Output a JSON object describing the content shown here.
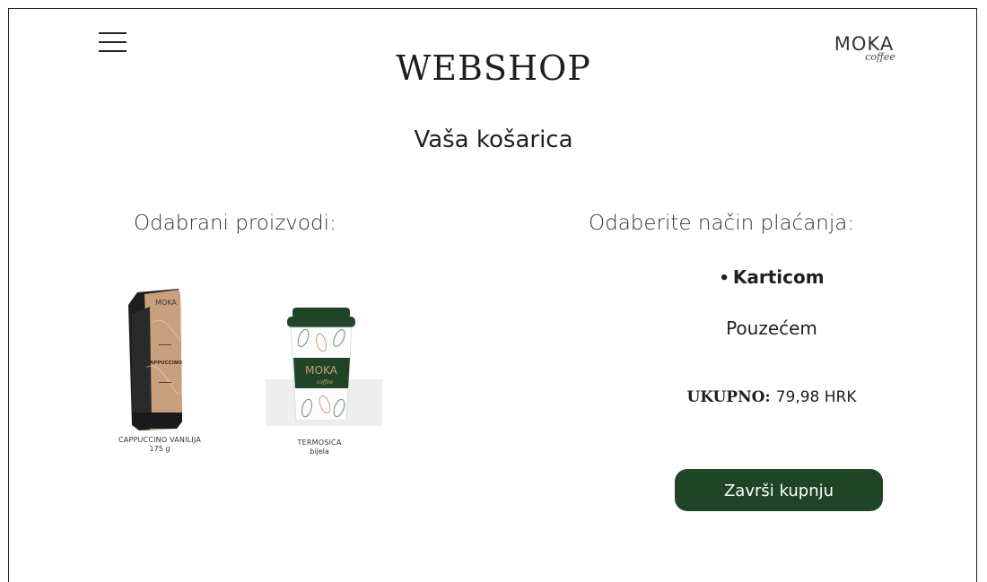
{
  "header": {
    "title": "WEBSHOP",
    "logo_main": "MOKA",
    "logo_sub": "coffee"
  },
  "cart": {
    "title": "Vaša košarica"
  },
  "products_section": {
    "heading": "Odabrani proizvodi:",
    "items": [
      {
        "name": "CAPPUCCINO VANILIJA",
        "detail": "175 g",
        "icon": "coffee-bag-image",
        "package_label": "CAPPUCCINO",
        "brand": "MOKA"
      },
      {
        "name": "TERMOSICA",
        "detail": "bijela",
        "icon": "thermos-cup-image",
        "brand": "MOKA",
        "brand_sub": "coffee"
      }
    ]
  },
  "payment_section": {
    "heading": "Odaberite način plaćanja:",
    "options": [
      {
        "label": "Karticom",
        "selected": true
      },
      {
        "label": "Pouzećem",
        "selected": false
      }
    ],
    "bullet": "•"
  },
  "total": {
    "label": "UKUPNO:",
    "value": "79,98 HRK"
  },
  "checkout": {
    "label": "Završi kupnju"
  },
  "colors": {
    "accent": "#1f4426",
    "text": "#1f1f1f",
    "bag_tan": "#c9a07e",
    "bag_dark": "#1e1e1e"
  }
}
